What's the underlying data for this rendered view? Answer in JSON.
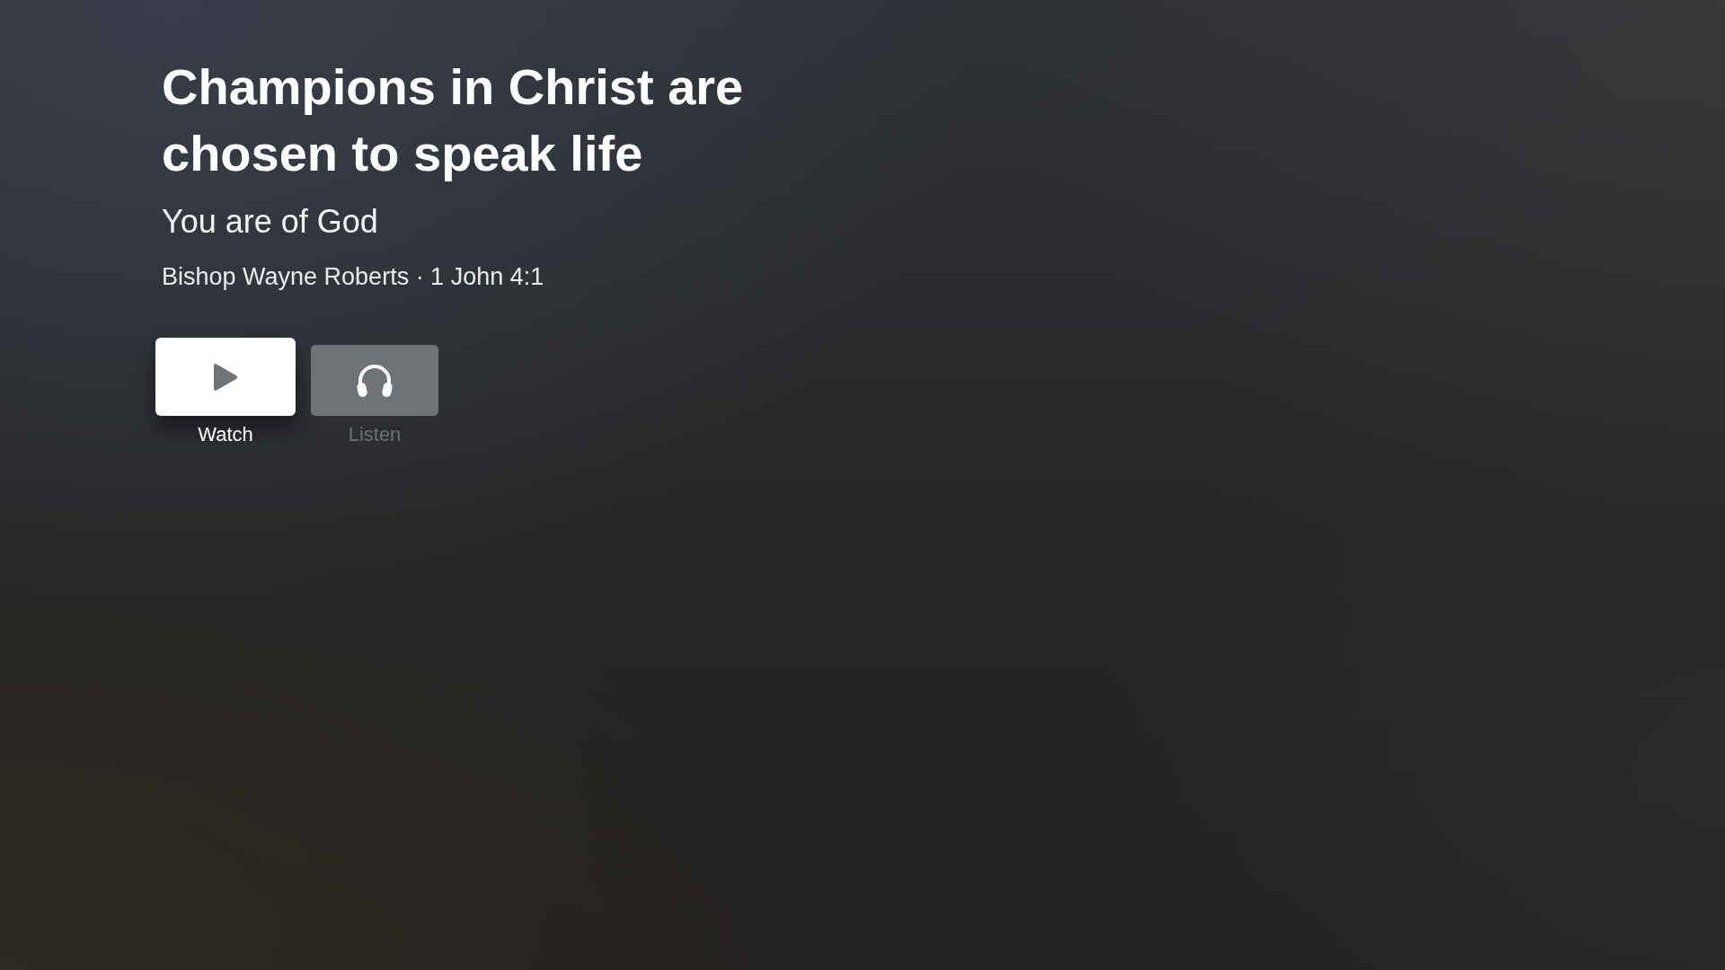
{
  "title": "Champions in Christ are chosen to speak life",
  "subtitle": "You are of God",
  "meta": "Bishop Wayne Roberts · 1 John 4:1",
  "actions": [
    {
      "label": "Watch",
      "kind": "play",
      "selected": true
    },
    {
      "label": "Listen",
      "kind": "headphones",
      "selected": false
    }
  ]
}
